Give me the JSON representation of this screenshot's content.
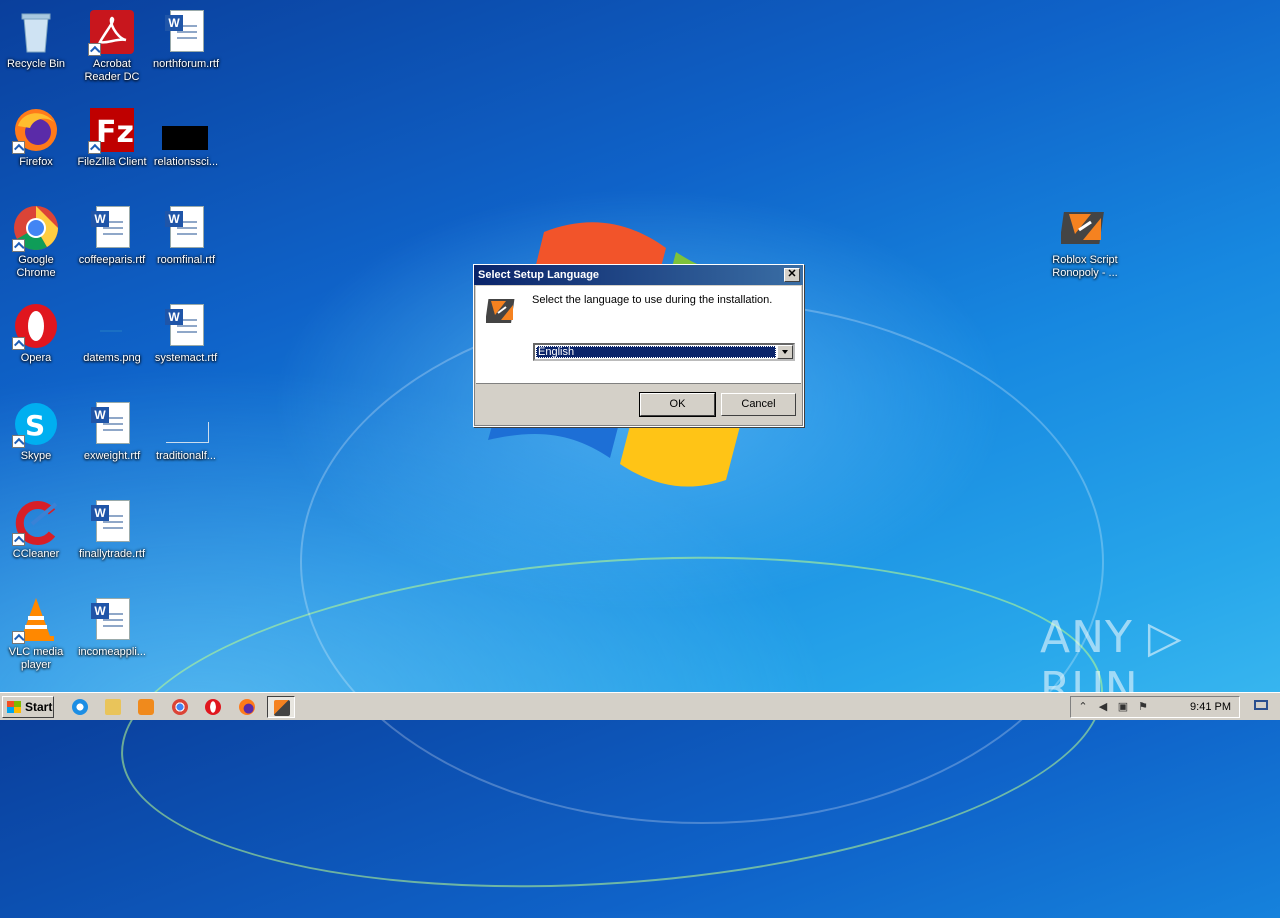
{
  "desktop": {
    "icons": [
      {
        "label": "Recycle Bin",
        "icon": "recycle-bin-icon"
      },
      {
        "label": "Acrobat Reader DC",
        "icon": "acrobat-icon"
      },
      {
        "label": "northforum.rtf",
        "icon": "word-document-icon"
      },
      {
        "label": "Firefox",
        "icon": "firefox-icon"
      },
      {
        "label": "FileZilla Client",
        "icon": "filezilla-icon"
      },
      {
        "label": "relationssci...",
        "icon": "black-file-icon"
      },
      {
        "label": "Google Chrome",
        "icon": "chrome-icon"
      },
      {
        "label": "coffeeparis.rtf",
        "icon": "word-document-icon"
      },
      {
        "label": "roomfinal.rtf",
        "icon": "word-document-icon"
      },
      {
        "label": "Opera",
        "icon": "opera-icon"
      },
      {
        "label": "datems.png",
        "icon": "image-file-icon"
      },
      {
        "label": "systemact.rtf",
        "icon": "word-document-icon"
      },
      {
        "label": "Skype",
        "icon": "skype-icon"
      },
      {
        "label": "exweight.rtf",
        "icon": "word-document-icon"
      },
      {
        "label": "traditionalf...",
        "icon": "image-file-icon"
      },
      {
        "label": "CCleaner",
        "icon": "ccleaner-icon"
      },
      {
        "label": "finallytrade.rtf",
        "icon": "word-document-icon"
      },
      {
        "label": "VLC media player",
        "icon": "vlc-icon"
      },
      {
        "label": "incomeappli...",
        "icon": "word-document-icon"
      },
      {
        "label": "Roblox Script Ronopoly - ...",
        "icon": "setup-app-icon"
      }
    ]
  },
  "dialog": {
    "title": "Select Setup Language",
    "close_glyph": "✕",
    "prompt": "Select the language to use during the installation.",
    "language_selected": "English",
    "ok_label": "OK",
    "cancel_label": "Cancel"
  },
  "taskbar": {
    "start_label": "Start",
    "clock": "9:41 PM",
    "items": [
      "internet-explorer-icon",
      "file-explorer-icon",
      "media-player-icon",
      "chrome-icon",
      "opera-icon",
      "firefox-icon",
      "setup-app-icon"
    ]
  },
  "watermark": "ANY ▷ RUN"
}
